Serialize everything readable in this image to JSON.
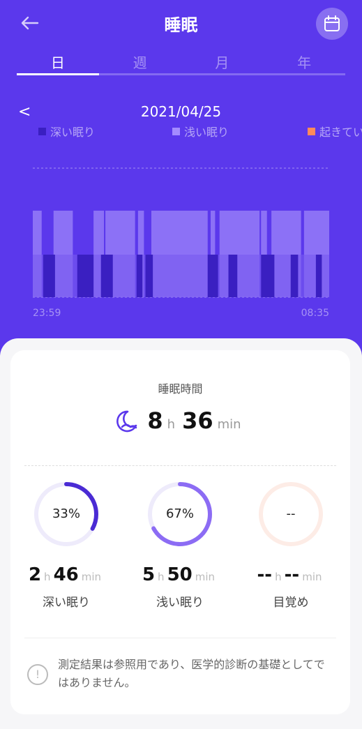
{
  "header": {
    "title": "睡眠",
    "back_icon": "arrow-left-icon",
    "calendar_icon": "calendar-icon"
  },
  "tabs": [
    {
      "label": "日",
      "active": true
    },
    {
      "label": "週",
      "active": false
    },
    {
      "label": "月",
      "active": false
    },
    {
      "label": "年",
      "active": false
    }
  ],
  "date_nav": {
    "prev": "<",
    "date": "2021/04/25"
  },
  "legend": [
    {
      "label": "深い眠り",
      "color": "#3A1FC1"
    },
    {
      "label": "浅い眠り",
      "color": "#A48BFF"
    },
    {
      "label": "起きてい",
      "color": "#FF8A5B"
    }
  ],
  "chart_data": {
    "type": "bar",
    "title": "",
    "x_start": "23:59",
    "x_end": "08:35",
    "series": [
      {
        "name": "深い眠り",
        "segments": [
          [
            0.035,
            0.075
          ],
          [
            0.15,
            0.205
          ],
          [
            0.23,
            0.27
          ],
          [
            0.35,
            0.37
          ],
          [
            0.38,
            0.405
          ],
          [
            0.59,
            0.625
          ],
          [
            0.66,
            0.69
          ],
          [
            0.77,
            0.815
          ],
          [
            0.87,
            0.895
          ],
          [
            0.955,
            0.975
          ]
        ]
      },
      {
        "name": "浅い眠り",
        "segments": [
          [
            0.0,
            0.03
          ],
          [
            0.07,
            0.135
          ],
          [
            0.205,
            0.235
          ],
          [
            0.235,
            0.24
          ],
          [
            0.245,
            0.345
          ],
          [
            0.355,
            0.375
          ],
          [
            0.4,
            0.59
          ],
          [
            0.6,
            0.615
          ],
          [
            0.63,
            0.765
          ],
          [
            0.77,
            0.79
          ],
          [
            0.805,
            0.905
          ],
          [
            0.915,
            1.0
          ]
        ]
      }
    ]
  },
  "summary": {
    "heading": "睡眠時間",
    "hours": "8",
    "h_unit": "h",
    "minutes": "36",
    "min_unit": "min"
  },
  "stats": [
    {
      "percent": "33%",
      "fraction": 0.33,
      "color": "#4A2BD4",
      "track": "#EEEBFB",
      "h": "2",
      "m": "46",
      "label": "深い眠り"
    },
    {
      "percent": "67%",
      "fraction": 0.67,
      "color": "#8C6CF4",
      "track": "#EEEBFB",
      "h": "5",
      "m": "50",
      "label": "浅い眠り"
    },
    {
      "percent": "--",
      "fraction": 0,
      "color": "#FF8A5B",
      "track": "#FDECE6",
      "h": "--",
      "m": "--",
      "label": "目覚め"
    }
  ],
  "units": {
    "h": "h",
    "min": "min"
  },
  "note": {
    "text": "測定結果は参照用であり、医学的診断の基礎としてではありません。",
    "icon": "info-icon"
  }
}
